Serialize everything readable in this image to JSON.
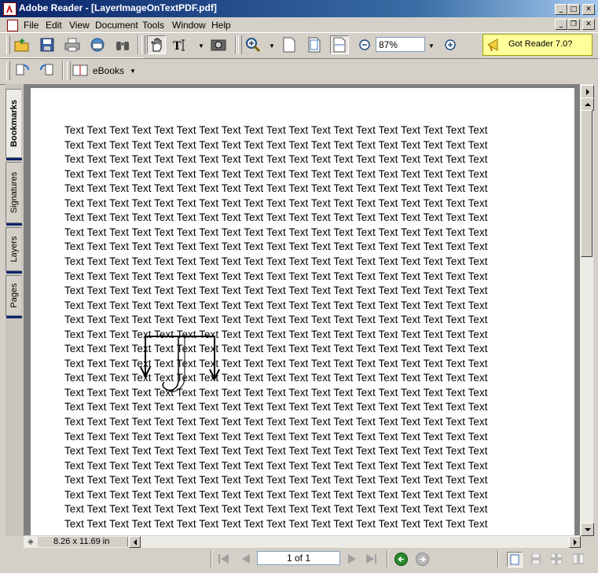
{
  "window": {
    "title": "Adobe Reader - [LayerImageOnTextPDF.pdf]",
    "controls": [
      "minimize",
      "maximize",
      "close"
    ]
  },
  "menu": {
    "items": [
      "File",
      "Edit",
      "View",
      "Document",
      "Tools",
      "Window",
      "Help"
    ]
  },
  "toolbar": {
    "zoom_value": "87%",
    "promo_label": "Got Reader 7.0?",
    "ebooks_label": "eBooks"
  },
  "nav_tabs": [
    "Bookmarks",
    "Signatures",
    "Layers",
    "Pages"
  ],
  "document": {
    "line_text": "Text Text Text Text Text Text Text Text Text Text Text Text Text Text Text Text Text Text Text",
    "line_count": 28
  },
  "status": {
    "page_size": "8.26 x 11.69 in",
    "page_indicator": "1 of 1"
  },
  "colors": {
    "titlebar_start": "#0a246a",
    "titlebar_end": "#a6caf0",
    "promo_bg": "#ffff99",
    "chrome": "#d4d0c8"
  }
}
